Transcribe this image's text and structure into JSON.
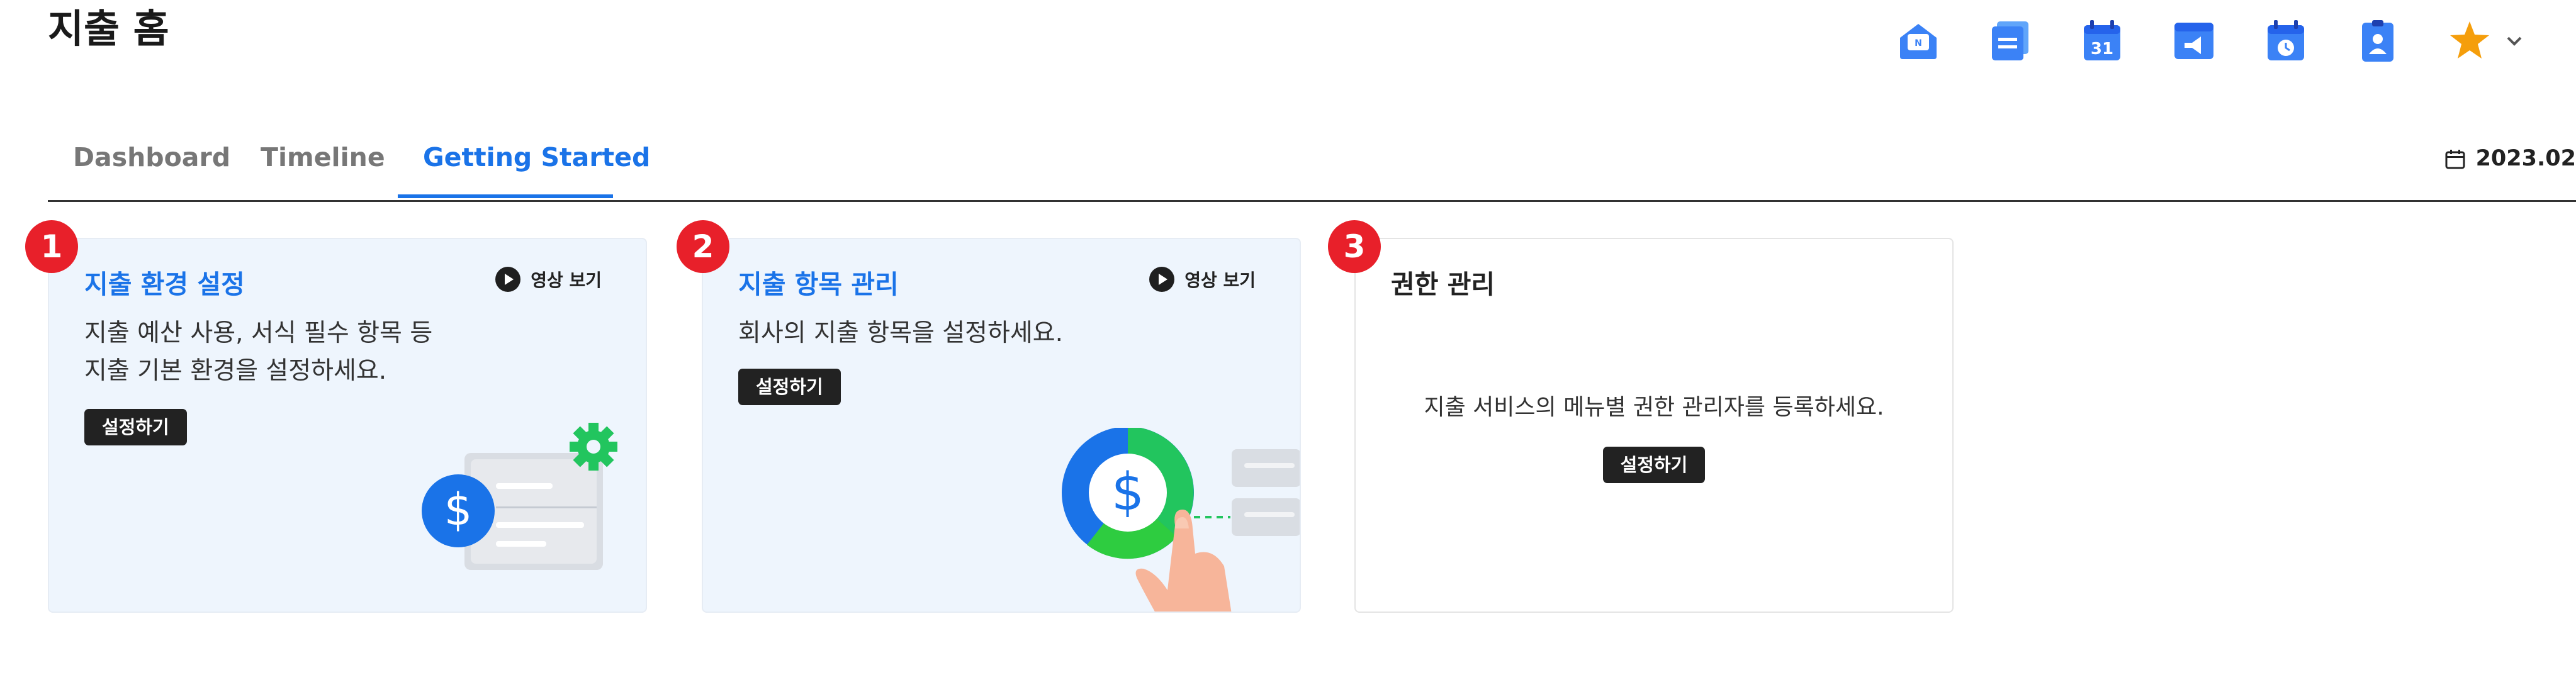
{
  "page": {
    "title": "지출 홈"
  },
  "app_icons": [
    {
      "name": "mail-icon",
      "color": "#3b82f6"
    },
    {
      "name": "board-icon",
      "color": "#3b82f6"
    },
    {
      "name": "calendar-icon",
      "color": "#3b82f6",
      "text": "31"
    },
    {
      "name": "announcement-icon",
      "color": "#3b82f6"
    },
    {
      "name": "schedule-icon",
      "color": "#3b82f6"
    },
    {
      "name": "contacts-icon",
      "color": "#3b82f6"
    },
    {
      "name": "star-icon",
      "color": "#f59e0b"
    }
  ],
  "tabs": [
    {
      "label": "Dashboard",
      "active": false
    },
    {
      "label": "Timeline",
      "active": false
    },
    {
      "label": "Getting Started",
      "active": true
    }
  ],
  "date_range": {
    "text": "2023.02",
    "icon": "calendar-icon"
  },
  "colors": {
    "accent": "#1a73e8",
    "badge": "#e8202a",
    "card_bg": "#eef5fd",
    "button": "#222222"
  },
  "cards": [
    {
      "step": "1",
      "title": "지출 환경 설정",
      "video_label": "영상 보기",
      "desc_lines": [
        "지출 예산 사용, 서식 필수 항목 등",
        "지출 기본 환경을 설정하세요."
      ],
      "button_label": "설정하기",
      "illustration": "document-dollar-gear-illustration"
    },
    {
      "step": "2",
      "title": "지출 항목 관리",
      "video_label": "영상 보기",
      "desc_lines": [
        "회사의 지출 항목을 설정하세요."
      ],
      "button_label": "설정하기",
      "illustration": "donut-dollar-hand-illustration"
    },
    {
      "step": "3",
      "title": "권한 관리",
      "desc_lines": [
        "지출 서비스의 메뉴별 권한 관리자를 등록하세요."
      ],
      "button_label": "설정하기"
    }
  ]
}
